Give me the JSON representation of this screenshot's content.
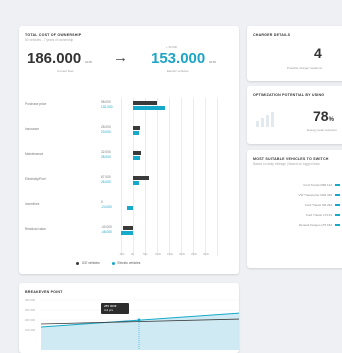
{
  "tco": {
    "title": "TOTAL COST OF OWNERSHIP",
    "subtitle": "50 vehicles - 7 years of ownership",
    "current_value": "186.000",
    "current_unit": "EUR",
    "current_label": "Current fleet",
    "ev_delta": "+ 33.000",
    "ev_value": "153.000",
    "ev_unit": "EUR",
    "ev_label": "Electric vehicles",
    "arrow": "→"
  },
  "charger": {
    "title": "CHARGER DETAILS",
    "value": "4",
    "label": "Possible charger locations"
  },
  "optimization": {
    "title": "OPTIMIZATION POTENTIAL BY USING",
    "value": "78",
    "unit": "%",
    "label": "Energy peak reduction"
  },
  "suitable": {
    "title": "MOST SUITABLE VEHICLES TO SWITCH",
    "subtitle": "Based on daily mileage | Based on logged data",
    "items": [
      {
        "name": "Ford Transit M66 123"
      },
      {
        "name": "VW Transporter M02 329"
      },
      {
        "name": "Ford Transit M6 294"
      },
      {
        "name": "Ford Transit LT4 64"
      },
      {
        "name": "Renault Kangoo LT5 184"
      }
    ]
  },
  "breakeven": {
    "title": "BREAKEVEN POINT",
    "tooltip_line1": "285 000€",
    "tooltip_line2": "4.2 yrs",
    "y_ticks": [
      "400 000",
      "300 000",
      "200 000",
      "100 000"
    ]
  },
  "legend": {
    "ice": "ICE vehicles",
    "ev": "Electric vehicles"
  },
  "colors": {
    "ice": "#3a3a3a",
    "ev": "#16a9c9"
  },
  "chart_data": {
    "type": "bar",
    "orientation": "horizontal",
    "categories": [
      "Purchase price",
      "Insurance",
      "Maintenance",
      "Electricity/Fuel",
      "Incentives",
      "Residual value"
    ],
    "series": [
      {
        "name": "ICE vehicles",
        "values": [
          98000,
          28000,
          32000,
          67000,
          0,
          -40000
        ]
      },
      {
        "name": "Electric vehicles",
        "values": [
          132000,
          23000,
          28000,
          26000,
          -24000,
          -48000
        ]
      }
    ],
    "value_labels": [
      [
        "98.000",
        "132.000"
      ],
      [
        "28.000",
        "23.000"
      ],
      [
        "32.000",
        "28.000"
      ],
      [
        "67.000",
        "26.000"
      ],
      [
        "0",
        "-24.000"
      ],
      [
        "-40.000",
        "-48.000"
      ]
    ],
    "x_ticks": [
      "-50k",
      "0k",
      "50k",
      "100k",
      "150k",
      "200k",
      "250k",
      "300k"
    ],
    "xlim": [
      -50000,
      300000
    ],
    "legend_position": "bottom"
  }
}
